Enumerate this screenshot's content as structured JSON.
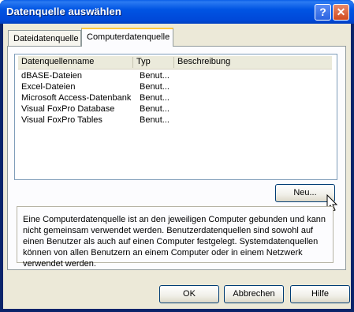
{
  "window": {
    "title": "Datenquelle auswählen",
    "help_glyph": "?",
    "close_glyph": "✕"
  },
  "tabs": [
    {
      "label": "Dateidatenquelle",
      "active": false
    },
    {
      "label": "Computerdatenquelle",
      "active": true
    }
  ],
  "list": {
    "columns": [
      "Datenquellenname",
      "Typ",
      "Beschreibung"
    ],
    "rows": [
      {
        "name": "dBASE-Dateien",
        "type": "Benut..."
      },
      {
        "name": "Excel-Dateien",
        "type": "Benut..."
      },
      {
        "name": "Microsoft Access-Datenbank",
        "type": "Benut..."
      },
      {
        "name": "Visual FoxPro Database",
        "type": "Benut..."
      },
      {
        "name": "Visual FoxPro Tables",
        "type": "Benut..."
      }
    ]
  },
  "buttons": {
    "new_label": "Neu...",
    "ok_label": "OK",
    "cancel_label": "Abbrechen",
    "help_label": "Hilfe"
  },
  "info_text": "Eine Computerdatenquelle ist an den jeweiligen Computer gebunden und kann nicht gemeinsam verwendet werden. Benutzerdatenquellen sind sowohl auf einen Benutzer als auch auf einen Computer festgelegt. Systemdatenquellen können von allen Benutzern an einem Computer oder in einem Netzwerk verwendet werden.",
  "colors": {
    "titlebar": "#0054e3",
    "dialog_bg": "#ece9d8",
    "active_tab_accent": "#ffc83c"
  }
}
